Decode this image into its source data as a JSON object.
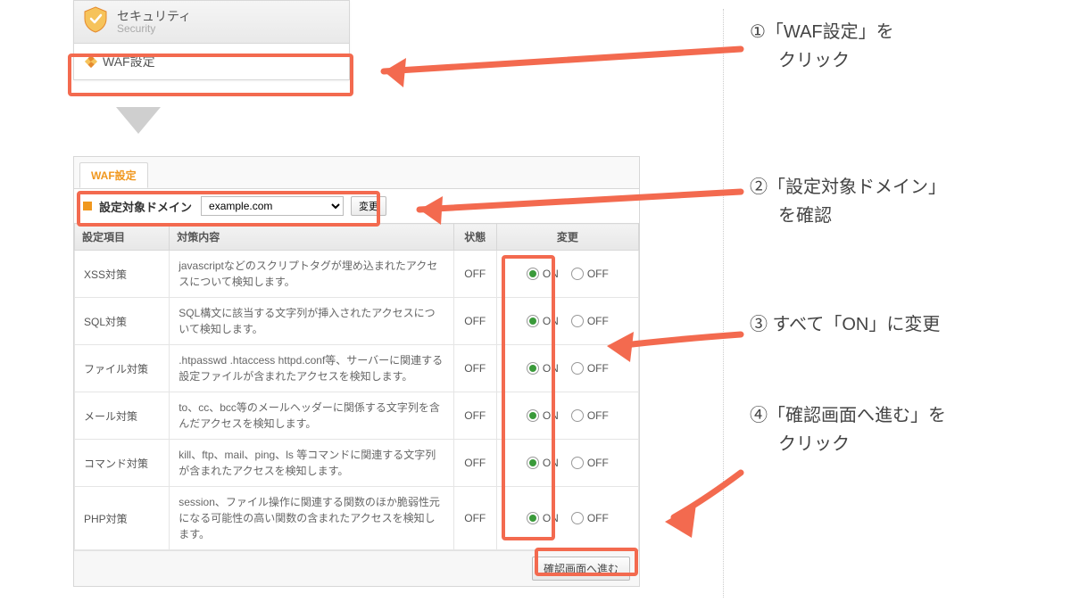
{
  "sec_card": {
    "title_jp": "セキュリティ",
    "title_en": "Security",
    "item_label": "WAF設定"
  },
  "panel": {
    "tab_label": "WAF設定",
    "domain_label": "設定対象ドメイン",
    "domain_value": "example.com",
    "change_btn": "変更",
    "headers": {
      "item": "設定項目",
      "desc": "対策内容",
      "state": "状態",
      "change": "変更"
    },
    "footer_btn": "確認画面へ進む",
    "on_label": "ON",
    "off_label": "OFF"
  },
  "rows": [
    {
      "item": "XSS対策",
      "desc": "javascriptなどのスクリプトタグが埋め込まれたアクセスについて検知します。",
      "state": "OFF",
      "selected": "ON"
    },
    {
      "item": "SQL対策",
      "desc": "SQL構文に該当する文字列が挿入されたアクセスについて検知します。",
      "state": "OFF",
      "selected": "ON"
    },
    {
      "item": "ファイル対策",
      "desc": ".htpasswd .htaccess httpd.conf等、サーバーに関連する設定ファイルが含まれたアクセスを検知します。",
      "state": "OFF",
      "selected": "ON"
    },
    {
      "item": "メール対策",
      "desc": "to、cc、bcc等のメールヘッダーに関係する文字列を含んだアクセスを検知します。",
      "state": "OFF",
      "selected": "ON"
    },
    {
      "item": "コマンド対策",
      "desc": "kill、ftp、mail、ping、ls 等コマンドに関連する文字列が含まれたアクセスを検知します。",
      "state": "OFF",
      "selected": "ON"
    },
    {
      "item": "PHP対策",
      "desc": "session、ファイル操作に関連する関数のほか脆弱性元になる可能性の高い関数の含まれたアクセスを検知します。",
      "state": "OFF",
      "selected": "ON"
    }
  ],
  "steps": {
    "s1a": "①「WAF設定」を",
    "s1b": "クリック",
    "s2a": "②「設定対象ドメイン」",
    "s2b": "を確認",
    "s3": "③ すべて「ON」に変更",
    "s4a": "④「確認画面へ進む」を",
    "s4b": "クリック"
  }
}
